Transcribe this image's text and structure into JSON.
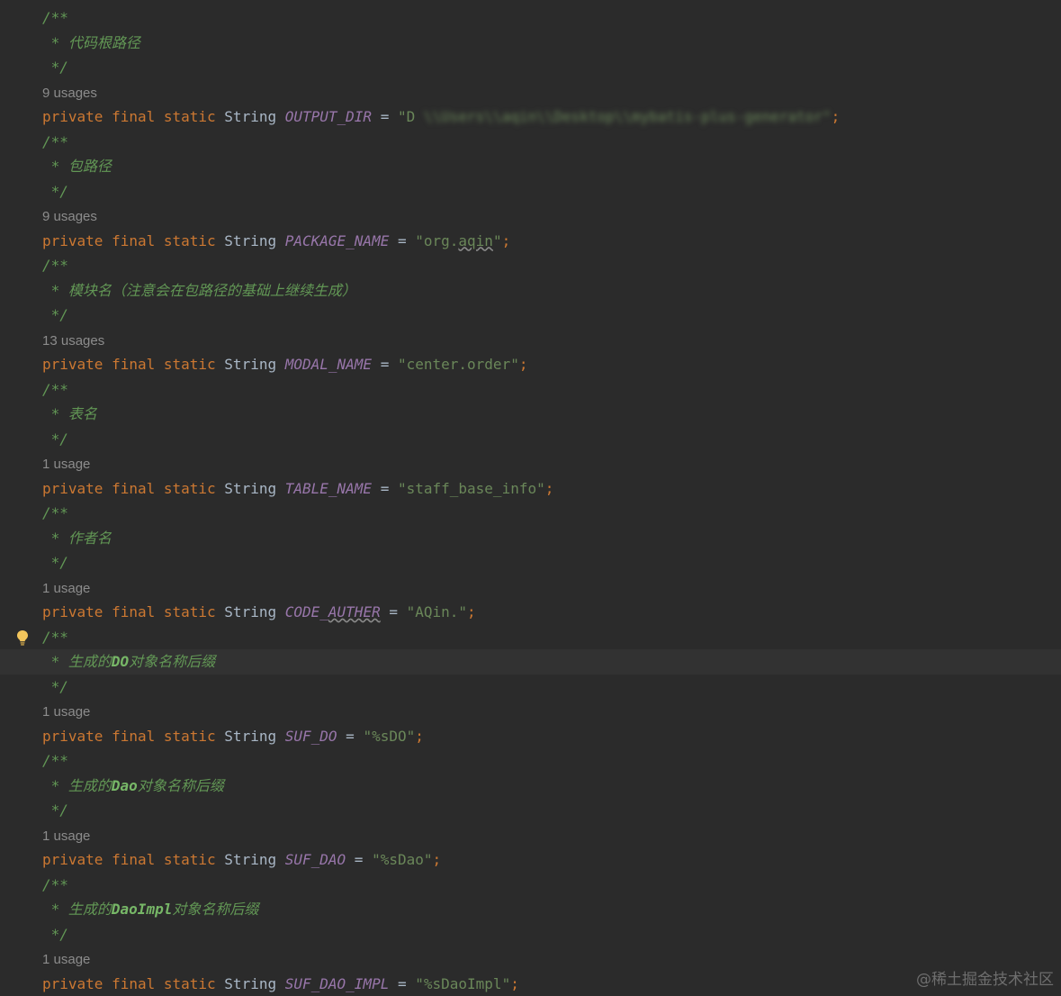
{
  "editor": {
    "lines": [
      {
        "kind": "doc",
        "parts": [
          {
            "t": "/**",
            "c": "doc"
          }
        ]
      },
      {
        "kind": "doc",
        "parts": [
          {
            "t": " * 代码根路径",
            "c": "doc"
          }
        ]
      },
      {
        "kind": "doc",
        "parts": [
          {
            "t": " */",
            "c": "doc"
          }
        ]
      },
      {
        "kind": "usage",
        "parts": [
          {
            "t": "9 usages",
            "c": "usage"
          }
        ]
      },
      {
        "kind": "code",
        "parts": [
          {
            "t": "private ",
            "c": "kw"
          },
          {
            "t": "final ",
            "c": "kw"
          },
          {
            "t": "static ",
            "c": "kw"
          },
          {
            "t": "String ",
            "c": "type"
          },
          {
            "t": "OUTPUT_DIR",
            "c": "field"
          },
          {
            "t": " = ",
            "c": "op"
          },
          {
            "t": "\"D",
            "c": "str"
          },
          {
            "t": " \\\\Users\\\\aqin\\\\Desktop\\\\mybatis-plus-generator\"",
            "c": "blurred"
          },
          {
            "t": ";",
            "c": "semi"
          }
        ]
      },
      {
        "kind": "doc",
        "parts": [
          {
            "t": "/**",
            "c": "doc"
          }
        ]
      },
      {
        "kind": "doc",
        "parts": [
          {
            "t": " * 包路径",
            "c": "doc"
          }
        ]
      },
      {
        "kind": "doc",
        "parts": [
          {
            "t": " */",
            "c": "doc"
          }
        ]
      },
      {
        "kind": "usage",
        "parts": [
          {
            "t": "9 usages",
            "c": "usage"
          }
        ]
      },
      {
        "kind": "code",
        "parts": [
          {
            "t": "private ",
            "c": "kw"
          },
          {
            "t": "final ",
            "c": "kw"
          },
          {
            "t": "static ",
            "c": "kw"
          },
          {
            "t": "String ",
            "c": "type"
          },
          {
            "t": "PACKAGE_NAME",
            "c": "field"
          },
          {
            "t": " = ",
            "c": "op"
          },
          {
            "t": "\"org.",
            "c": "str"
          },
          {
            "t": "aqin",
            "c": "str typo"
          },
          {
            "t": "\"",
            "c": "str"
          },
          {
            "t": ";",
            "c": "semi"
          }
        ]
      },
      {
        "kind": "doc",
        "parts": [
          {
            "t": "/**",
            "c": "doc"
          }
        ]
      },
      {
        "kind": "doc",
        "parts": [
          {
            "t": " * 模块名（注意会在包路径的基础上继续生成）",
            "c": "doc"
          }
        ]
      },
      {
        "kind": "doc",
        "parts": [
          {
            "t": " */",
            "c": "doc"
          }
        ]
      },
      {
        "kind": "usage",
        "parts": [
          {
            "t": "13 usages",
            "c": "usage"
          }
        ]
      },
      {
        "kind": "code",
        "parts": [
          {
            "t": "private ",
            "c": "kw"
          },
          {
            "t": "final ",
            "c": "kw"
          },
          {
            "t": "static ",
            "c": "kw"
          },
          {
            "t": "String ",
            "c": "type"
          },
          {
            "t": "MODAL_NAME",
            "c": "field"
          },
          {
            "t": " = ",
            "c": "op"
          },
          {
            "t": "\"center.order\"",
            "c": "str"
          },
          {
            "t": ";",
            "c": "semi"
          }
        ]
      },
      {
        "kind": "doc",
        "parts": [
          {
            "t": "/**",
            "c": "doc"
          }
        ]
      },
      {
        "kind": "doc",
        "parts": [
          {
            "t": " * 表名",
            "c": "doc"
          }
        ]
      },
      {
        "kind": "doc",
        "parts": [
          {
            "t": " */",
            "c": "doc"
          }
        ]
      },
      {
        "kind": "usage",
        "parts": [
          {
            "t": "1 usage",
            "c": "usage"
          }
        ]
      },
      {
        "kind": "code",
        "parts": [
          {
            "t": "private ",
            "c": "kw"
          },
          {
            "t": "final ",
            "c": "kw"
          },
          {
            "t": "static ",
            "c": "kw"
          },
          {
            "t": "String ",
            "c": "type"
          },
          {
            "t": "TABLE_NAME",
            "c": "field"
          },
          {
            "t": " = ",
            "c": "op"
          },
          {
            "t": "\"staff_base_info\"",
            "c": "str"
          },
          {
            "t": ";",
            "c": "semi"
          }
        ]
      },
      {
        "kind": "doc",
        "parts": [
          {
            "t": "/**",
            "c": "doc"
          }
        ]
      },
      {
        "kind": "doc",
        "parts": [
          {
            "t": " * 作者名",
            "c": "doc"
          }
        ]
      },
      {
        "kind": "doc",
        "parts": [
          {
            "t": " */",
            "c": "doc"
          }
        ]
      },
      {
        "kind": "usage",
        "parts": [
          {
            "t": "1 usage",
            "c": "usage"
          }
        ]
      },
      {
        "kind": "code",
        "parts": [
          {
            "t": "private ",
            "c": "kw"
          },
          {
            "t": "final ",
            "c": "kw"
          },
          {
            "t": "static ",
            "c": "kw"
          },
          {
            "t": "String ",
            "c": "type"
          },
          {
            "t": "CODE_",
            "c": "field"
          },
          {
            "t": "AUTHER",
            "c": "field typo"
          },
          {
            "t": " = ",
            "c": "op"
          },
          {
            "t": "\"AQin.\"",
            "c": "str"
          },
          {
            "t": ";",
            "c": "semi"
          }
        ]
      },
      {
        "kind": "doc",
        "bulb": true,
        "parts": [
          {
            "t": "/**",
            "c": "doc"
          }
        ]
      },
      {
        "kind": "doc",
        "highlighted": true,
        "parts": [
          {
            "t": " * 生成的",
            "c": "doc"
          },
          {
            "t": "DO",
            "c": "doc-ident"
          },
          {
            "t": "对象名称后缀",
            "c": "doc"
          }
        ]
      },
      {
        "kind": "doc",
        "parts": [
          {
            "t": " */",
            "c": "doc"
          }
        ]
      },
      {
        "kind": "usage",
        "parts": [
          {
            "t": "1 usage",
            "c": "usage"
          }
        ]
      },
      {
        "kind": "code",
        "parts": [
          {
            "t": "private ",
            "c": "kw"
          },
          {
            "t": "final ",
            "c": "kw"
          },
          {
            "t": "static ",
            "c": "kw"
          },
          {
            "t": "String ",
            "c": "type"
          },
          {
            "t": "SUF_DO",
            "c": "field"
          },
          {
            "t": " = ",
            "c": "op"
          },
          {
            "t": "\"%sDO\"",
            "c": "str"
          },
          {
            "t": ";",
            "c": "semi"
          }
        ]
      },
      {
        "kind": "doc",
        "parts": [
          {
            "t": "/**",
            "c": "doc"
          }
        ]
      },
      {
        "kind": "doc",
        "parts": [
          {
            "t": " * 生成的",
            "c": "doc"
          },
          {
            "t": "Dao",
            "c": "doc-ident"
          },
          {
            "t": "对象名称后缀",
            "c": "doc"
          }
        ]
      },
      {
        "kind": "doc",
        "parts": [
          {
            "t": " */",
            "c": "doc"
          }
        ]
      },
      {
        "kind": "usage",
        "parts": [
          {
            "t": "1 usage",
            "c": "usage"
          }
        ]
      },
      {
        "kind": "code",
        "parts": [
          {
            "t": "private ",
            "c": "kw"
          },
          {
            "t": "final ",
            "c": "kw"
          },
          {
            "t": "static ",
            "c": "kw"
          },
          {
            "t": "String ",
            "c": "type"
          },
          {
            "t": "SUF_DAO",
            "c": "field"
          },
          {
            "t": " = ",
            "c": "op"
          },
          {
            "t": "\"%sDao\"",
            "c": "str"
          },
          {
            "t": ";",
            "c": "semi"
          }
        ]
      },
      {
        "kind": "doc",
        "parts": [
          {
            "t": "/**",
            "c": "doc"
          }
        ]
      },
      {
        "kind": "doc",
        "parts": [
          {
            "t": " * 生成的",
            "c": "doc"
          },
          {
            "t": "DaoImpl",
            "c": "doc-ident"
          },
          {
            "t": "对象名称后缀",
            "c": "doc"
          }
        ]
      },
      {
        "kind": "doc",
        "parts": [
          {
            "t": " */",
            "c": "doc"
          }
        ]
      },
      {
        "kind": "usage",
        "parts": [
          {
            "t": "1 usage",
            "c": "usage"
          }
        ]
      },
      {
        "kind": "code",
        "parts": [
          {
            "t": "private ",
            "c": "kw"
          },
          {
            "t": "final ",
            "c": "kw"
          },
          {
            "t": "static ",
            "c": "kw"
          },
          {
            "t": "String ",
            "c": "type"
          },
          {
            "t": "SUF_DAO_IMPL",
            "c": "field"
          },
          {
            "t": " = ",
            "c": "op"
          },
          {
            "t": "\"%sDaoImpl\"",
            "c": "str"
          },
          {
            "t": ";",
            "c": "semi"
          }
        ]
      }
    ]
  },
  "watermark": "@稀土掘金技术社区",
  "icons": {
    "intention_bulb": "lightbulb-icon"
  },
  "colors": {
    "background": "#2b2b2b",
    "keyword": "#cc7832",
    "field": "#9876aa",
    "string": "#6a8759",
    "doc_comment": "#629755",
    "usage_hint": "#8c8c8c",
    "bulb": "#f2c55c"
  }
}
